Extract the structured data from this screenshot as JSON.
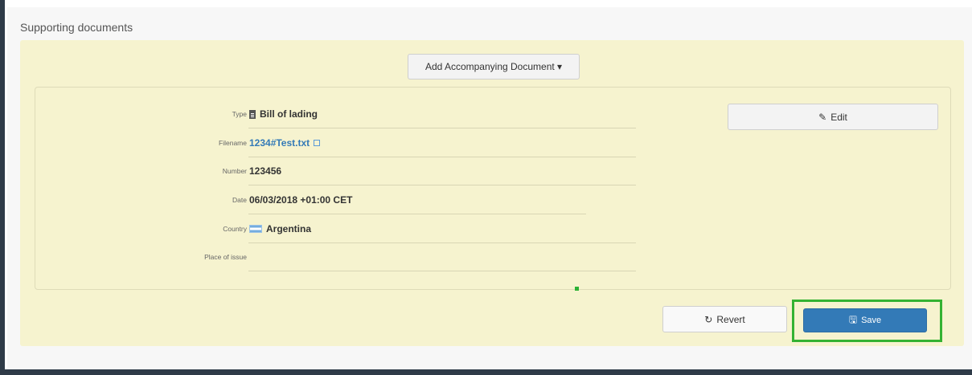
{
  "panel": {
    "title": "Supporting documents",
    "add_document_label": "Add Accompanying Document ▾"
  },
  "document": {
    "fields": [
      {
        "label": "Type",
        "value": "Bill of lading",
        "icon": "document-icon"
      },
      {
        "label": "Filename",
        "value": "1234#Test.txt",
        "icon": "external-link-icon",
        "is_link": true
      },
      {
        "label": "Number",
        "value": "123456"
      },
      {
        "label": "Date",
        "value": "06/03/2018 +01:00 CET"
      },
      {
        "label": "Country",
        "value": "Argentina",
        "icon": "argentina-flag-icon"
      },
      {
        "label": "Place of issue",
        "value": ""
      }
    ],
    "edit_label": "Edit"
  },
  "actions": {
    "revert_label": "Revert",
    "save_label": "Save"
  },
  "colors": {
    "panel_bg": "#f6f3cf",
    "primary": "#337ab7",
    "highlight": "#34b233"
  }
}
